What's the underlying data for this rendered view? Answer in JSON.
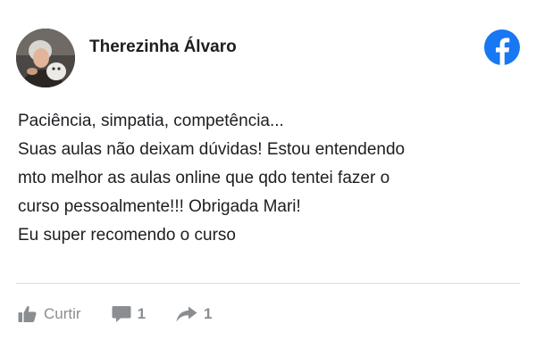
{
  "post": {
    "author": "Therezinha Álvaro",
    "review_lines": [
      "Paciência, simpatia, competência...",
      "Suas aulas não deixam dúvidas! Estou entendendo",
      "mto melhor as aulas online que qdo tentei fazer o",
      "curso pessoalmente!!! Obrigada Mari!",
      "Eu super recomendo o curso"
    ]
  },
  "actions": {
    "like_label": "Curtir",
    "comments_count": "1",
    "shares_count": "1"
  },
  "icons": {
    "brand": "facebook-icon",
    "like": "thumbs-up-icon",
    "comment": "comment-icon",
    "share": "share-arrow-icon"
  },
  "colors": {
    "facebook_blue": "#1877f2",
    "text": "#1c1e21",
    "muted_gray": "#8a8d91",
    "divider": "#dadde1"
  }
}
